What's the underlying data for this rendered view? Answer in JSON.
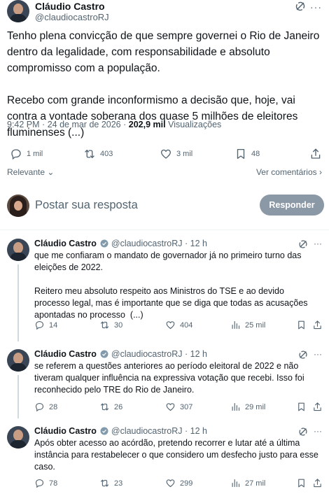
{
  "tweet": {
    "author_name": "Cláudio Castro",
    "author_handle": "@claudiocastroRJ",
    "text": "Tenho plena convicção de que sempre governei o Rio de Janeiro dentro da legalidade, com responsabilidade e absoluto compromisso com a população.\n\nRecebo com grande inconformismo a decisão que, hoje, vai contra a vontade soberana dos quase 5 milhões de eleitores fluminenses (...)",
    "time": "9:42 PM",
    "date": "24 de mar de 2026",
    "views_count": "202,9 mil",
    "views_label": "Visualizações",
    "replies": "1 mil",
    "reposts": "403",
    "likes": "3 mil",
    "bookmarks": "48"
  },
  "sort_label": "Relevante",
  "view_comments_label": "Ver comentários",
  "compose": {
    "placeholder": "Postar sua resposta",
    "reply_button": "Responder"
  },
  "replies": [
    {
      "name": "Cláudio Castro",
      "handle": "@claudiocastroRJ",
      "age": "12 h",
      "text": "que me confiaram o mandato de governador já no primeiro turno das eleições de 2022.\n\nReitero meu absoluto respeito aos Ministros do TSE e ao devido processo legal, mas é importante que se diga que todas as acusações apontadas no processo  (...)",
      "replies": "14",
      "reposts": "30",
      "likes": "404",
      "views": "25 mil"
    },
    {
      "name": "Cláudio Castro",
      "handle": "@claudiocastroRJ",
      "age": "12 h",
      "text": "se referem a questões anteriores ao período eleitoral de 2022 e não tiveram qualquer influência na expressiva votação que recebi. Isso foi reconhecido pelo TRE do Rio de Janeiro.",
      "replies": "28",
      "reposts": "26",
      "likes": "307",
      "views": "29 mil"
    },
    {
      "name": "Cláudio Castro",
      "handle": "@claudiocastroRJ",
      "age": "12 h",
      "text": "Após obter acesso ao acórdão, pretendo recorrer e lutar até a última instância para restabelecer o que considero um desfecho justo para esse caso.",
      "replies": "78",
      "reposts": "23",
      "likes": "299",
      "views": "27 mil"
    }
  ],
  "colors": {
    "text": "#0f1419",
    "secondary": "#536471",
    "verified": "#829aab",
    "divider": "#eff3f4",
    "button_disabled": "#8b98a5"
  }
}
